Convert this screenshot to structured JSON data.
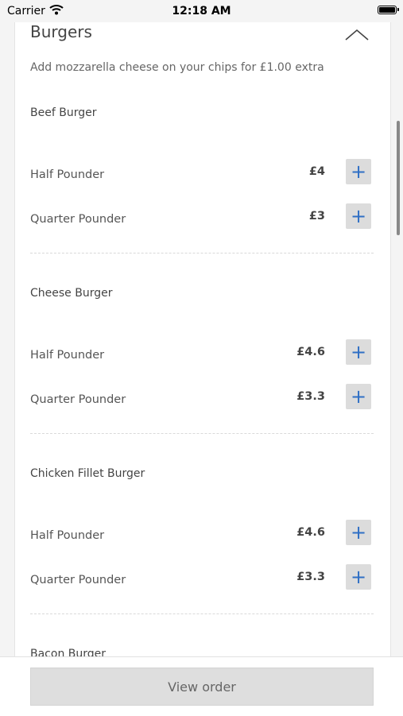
{
  "status_bar": {
    "carrier": "Carrier",
    "time": "12:18 AM"
  },
  "section": {
    "title": "Burgers",
    "subtitle": "Add mozzarella cheese on your chips for £1.00 extra"
  },
  "groups": [
    {
      "name": "Beef Burger",
      "items": [
        {
          "label": "Half Pounder",
          "price": "£4"
        },
        {
          "label": "Quarter Pounder",
          "price": "£3"
        }
      ]
    },
    {
      "name": "Cheese Burger",
      "items": [
        {
          "label": "Half Pounder",
          "price": "£4.6"
        },
        {
          "label": "Quarter Pounder",
          "price": "£3.3"
        }
      ]
    },
    {
      "name": "Chicken Fillet Burger",
      "items": [
        {
          "label": "Half Pounder",
          "price": "£4.6"
        },
        {
          "label": "Quarter Pounder",
          "price": "£3.3"
        }
      ]
    },
    {
      "name": "Bacon Burger",
      "items": []
    }
  ],
  "add_symbol": "+",
  "footer": {
    "view_order_label": "View order"
  },
  "icons": {
    "collapse": "chevron-up-icon",
    "add": "plus-icon",
    "wifi": "wifi-icon",
    "battery": "battery-icon"
  },
  "colors": {
    "accent": "#2f6fc5",
    "button_bg": "#dcdcdc"
  }
}
